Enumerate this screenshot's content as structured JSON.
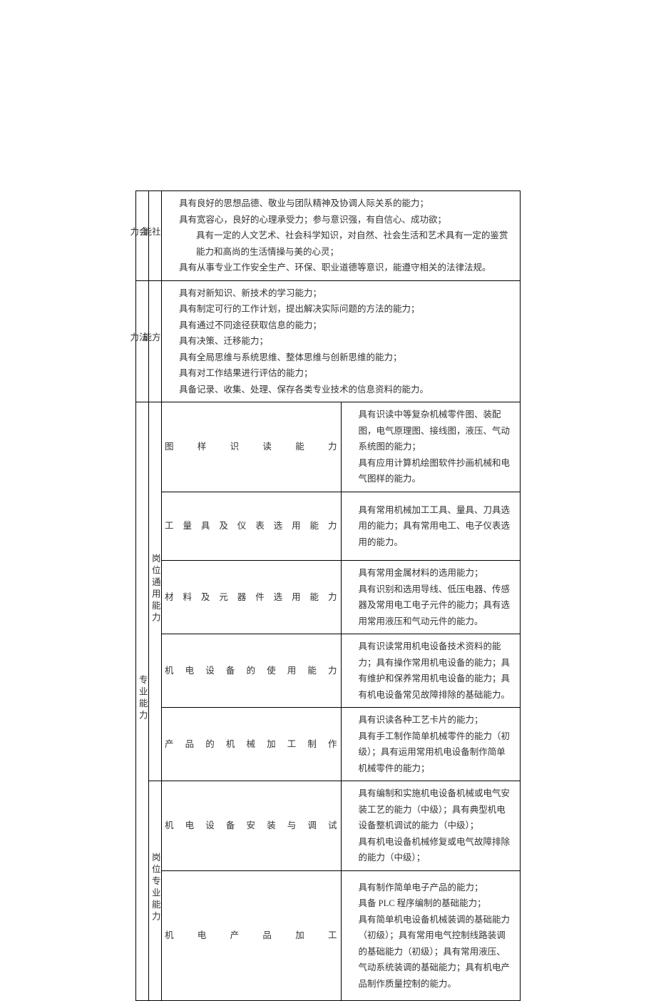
{
  "rows": {
    "social_label_l1": "社",
    "social_label_l2": "会",
    "social_label_l3": "能",
    "social_label_l4": "力",
    "social_c1": "具有良好的思想品德、敬业与团队精神及协调人际关系的能力；",
    "social_c2": "具有宽容心，良好的心理承受力；参与意识强，有自信心、成功欲；",
    "social_c3": "具有一定的人文艺术、社会科学知识，对自然、社会生活和艺术具有一定的鉴赏能力和高尚的生活情操与美的心灵；",
    "social_c4": "具有从事专业工作安全生产、环保、职业道德等意识，能遵守相关的法律法规。",
    "method_label_l1": "方",
    "method_label_l2": "法",
    "method_label_l3": "能",
    "method_label_l4": "力",
    "method_c1": "具有对新知识、新技术的学习能力；",
    "method_c2": "具有制定可行的工作计划，提出解决实际问题的方法的能力；",
    "method_c3": "具有通过不同途径获取信息的能力；",
    "method_c4": "具有决策、迁移能力；",
    "method_c5": "具有全局思维与系统思维、整体思维与创新思维的能力；",
    "method_c6": "具有对工作结果进行评估的能力；",
    "method_c7": "具备记录、收集、处理、保存各类专业技术的信息资料的能力。",
    "pro_label": "专业能力",
    "general_label": "岗位通用能力",
    "specific_label": "岗位专业能力",
    "g1_m": "图样识读能力",
    "g1_c1": "具有识读中等复杂机械零件图、装配图，电气原理图、接线图，液压、气动系统图的能力；",
    "g1_c2": "具有应用计算机绘图软件抄画机械和电气图样的能力。",
    "g2_m": "工量具及仪表选用能力",
    "g2_c": "具有常用机械加工工具、量具、刀具选用的能力；具有常用电工、电子仪表选用的能力。",
    "g3_m": "材料及元器件选用能力",
    "g3_c1": "具有常用金属材料的选用能力；",
    "g3_c2": "具有识别和选用导线、低压电器、传感器及常用电工电子元件的能力；具有选用常用液压和气动元件的能力。",
    "g4_m": "机电设备的使用能力",
    "g4_c": "具有识读常用机电设备技术资料的能力；具有操作常用机电设备的能力；具有维护和保养常用机电设备的能力；具有机电设备常见故障排除的基础能力。",
    "g5_m": "产品的机械加工制作",
    "g5_c1": "具有识读各种工艺卡片的能力；",
    "g5_c2": "具有手工制作简单机械零件的能力（初级）；具有运用常用机电设备制作简单机械零件的能力；",
    "s1_m": "机电设备安装与调试",
    "s1_c1": "具有编制和实施机电设备机械或电气安装工艺的能力（中级）；具有典型机电设备整机调试的能力（中级）；",
    "s1_c2": "具有机电设备机械修复或电气故障排除的能力（中级）；",
    "s2_m": "机电产品加工",
    "s2_c1": "具有制作简单电子产品的能力；",
    "s2_c2": "具备 PLC 程序编制的基础能力；",
    "s2_c3": "具有简单机电设备机械装调的基础能力（初级）；具有常用电气控制线路装调的基础能力（初级）；具有常用液压、气动系统装调的基础能力；具有机电产品制作质量控制的能力。"
  }
}
